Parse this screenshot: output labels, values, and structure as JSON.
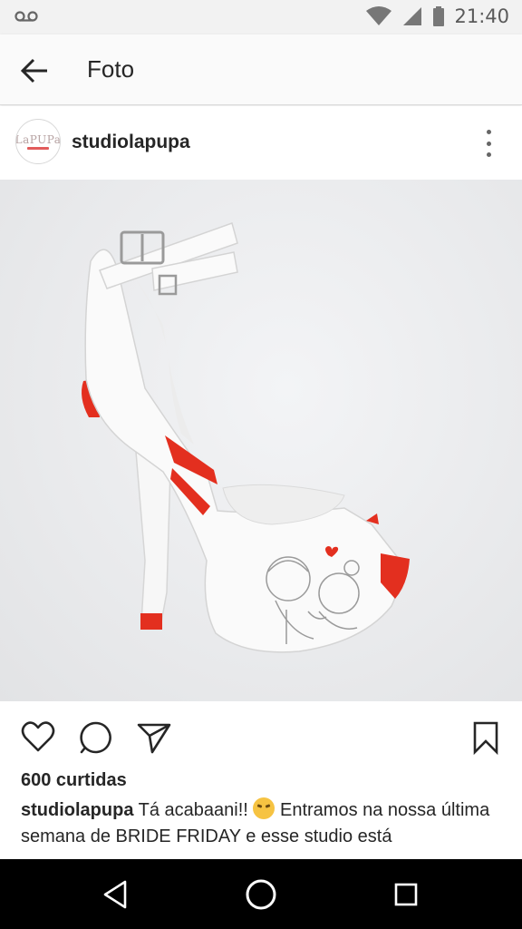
{
  "status_bar": {
    "time": "21:40",
    "icons": [
      "voicemail-icon",
      "wifi-icon",
      "cell-signal-icon",
      "battery-icon"
    ]
  },
  "app_bar": {
    "title": "Foto",
    "back_icon": "arrow-back-icon"
  },
  "post": {
    "username": "studiolapupa",
    "avatar_text": "LaPUPa",
    "more_icon": "more-vertical-icon",
    "photo_description_icon": "wedding-shoe-photo"
  },
  "actions": {
    "like_icon": "heart-icon",
    "comment_icon": "comment-icon",
    "share_icon": "direct-send-icon",
    "save_icon": "bookmark-icon"
  },
  "likes": "600 curtidas",
  "caption": {
    "username": "studiolapupa",
    "text_before_emoji": "Tá acabaani!!",
    "text_after_emoji": "Entramos na nossa última semana de BRIDE FRIDAY e esse studio está"
  },
  "nav_bar": {
    "back": "nav-back-icon",
    "home": "nav-home-icon",
    "recents": "nav-recents-icon"
  },
  "colors": {
    "accent_red": "#e32f1f",
    "text": "#262626"
  }
}
